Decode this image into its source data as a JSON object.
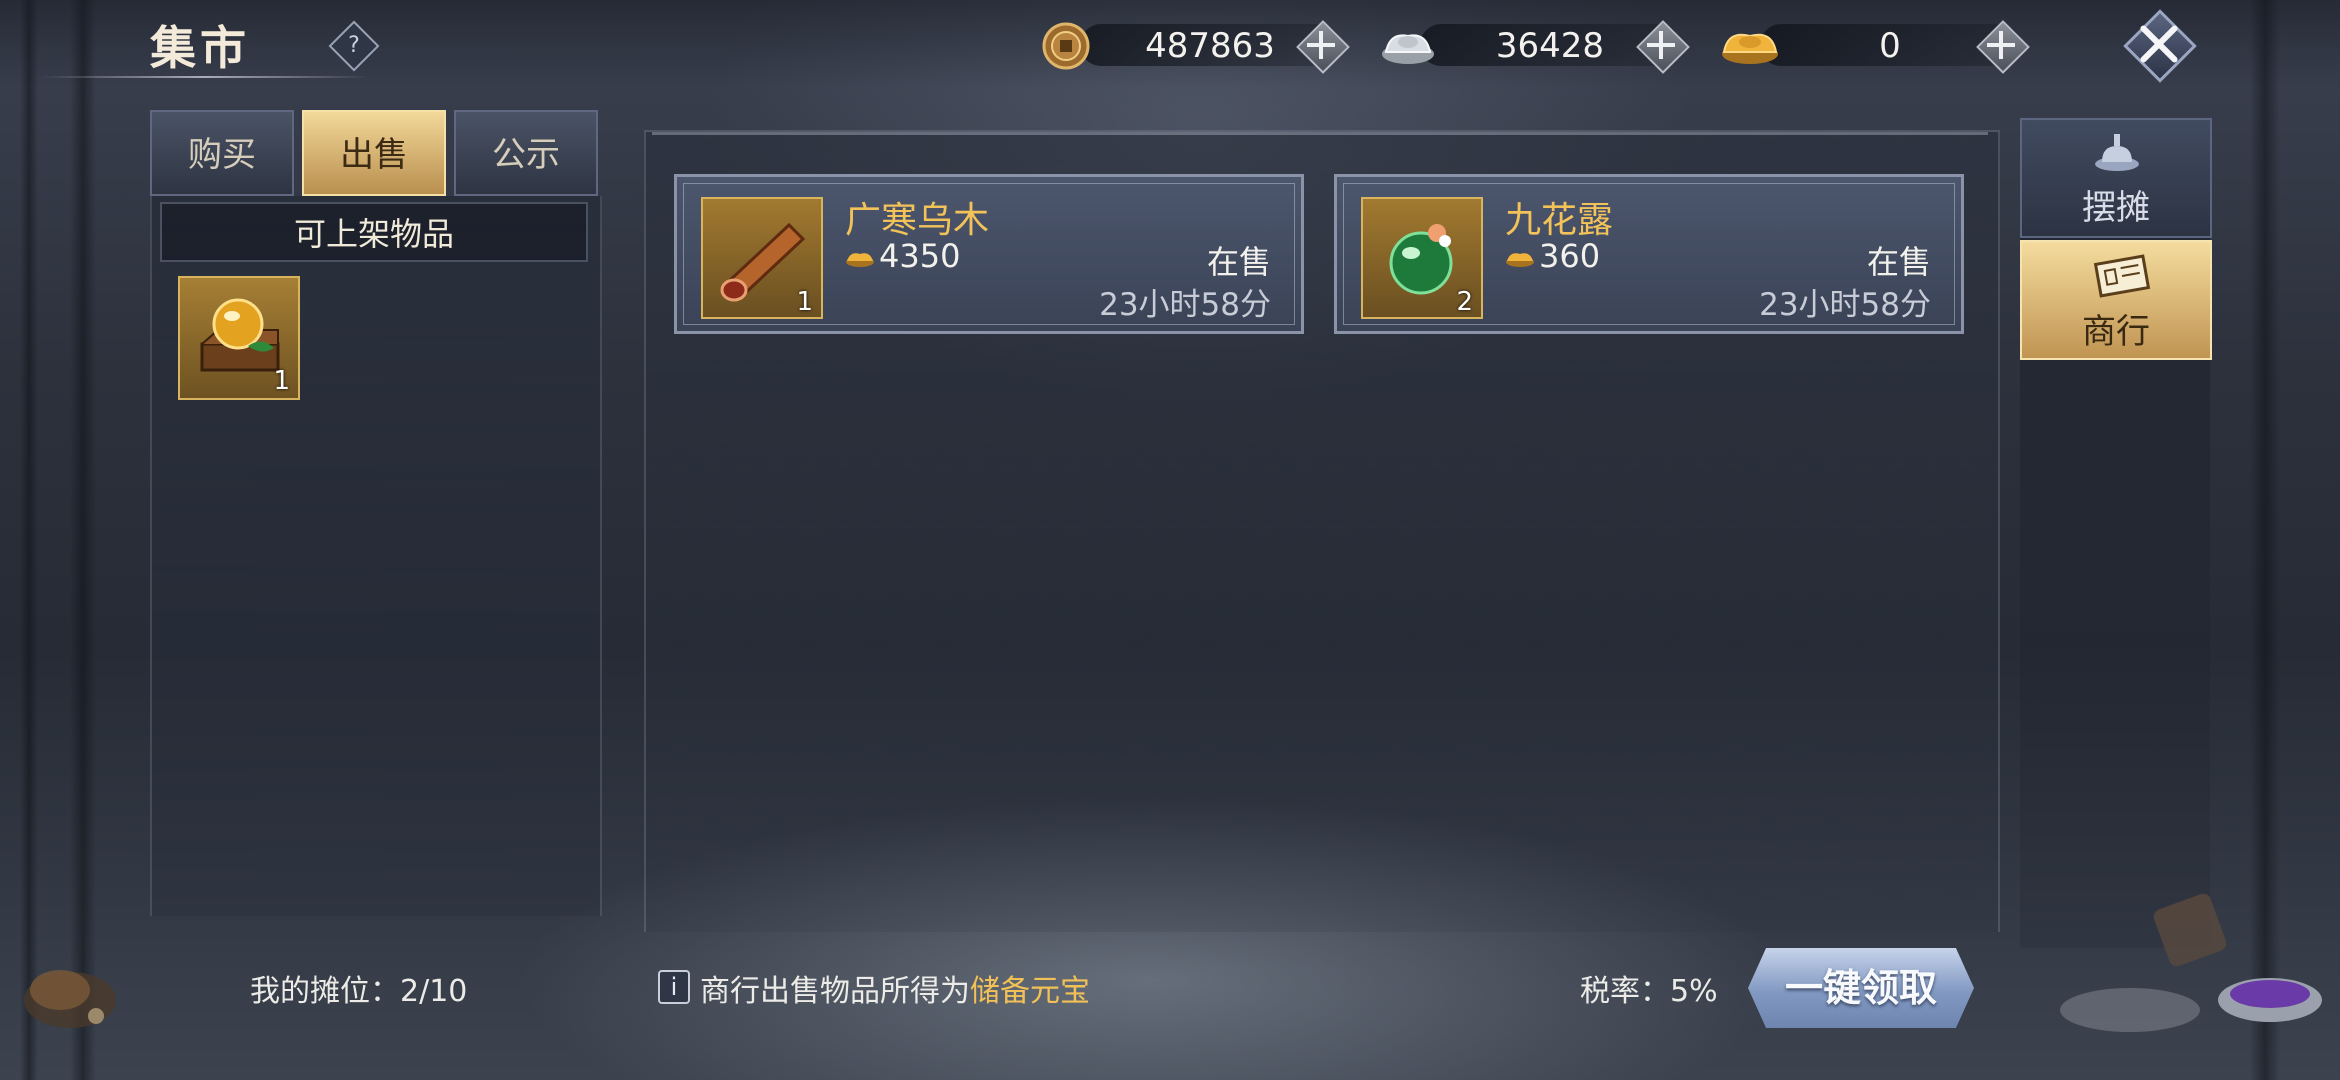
{
  "header": {
    "title": "集市",
    "help_label": "?",
    "currencies": [
      {
        "icon": "copper-coin-icon",
        "value": "487863"
      },
      {
        "icon": "silver-ingot-icon",
        "value": "36428"
      },
      {
        "icon": "gold-ingot-icon",
        "value": "0"
      }
    ]
  },
  "tabs": [
    {
      "label": "购买",
      "active": false
    },
    {
      "label": "出售",
      "active": true
    },
    {
      "label": "公示",
      "active": false
    }
  ],
  "inventory": {
    "header": "可上架物品",
    "items": [
      {
        "icon": "potion-crate-icon",
        "count": "1"
      }
    ]
  },
  "listings": [
    {
      "name": "广寒乌木",
      "icon": "ebony-wood-icon",
      "count": "1",
      "price": "4350",
      "status": "在售",
      "time_left": "23小时58分"
    },
    {
      "name": "九花露",
      "icon": "green-elixir-icon",
      "count": "2",
      "price": "360",
      "status": "在售",
      "time_left": "23小时58分"
    }
  ],
  "side_tabs": [
    {
      "label": "摆摊",
      "icon": "stall-icon",
      "active": false
    },
    {
      "label": "商行",
      "icon": "trade-house-icon",
      "active": true
    }
  ],
  "footer": {
    "stall_count": "我的摊位：2/10",
    "info_icon": "i",
    "note_prefix": "商行出售物品所得为",
    "note_highlight": "储备元宝",
    "tax_rate": "税率：5%",
    "claim_button": "一键领取"
  },
  "colors": {
    "accent_gold": "#f3c35a",
    "active_tab": "#f2d89a",
    "claim_button": "#8299c2"
  }
}
